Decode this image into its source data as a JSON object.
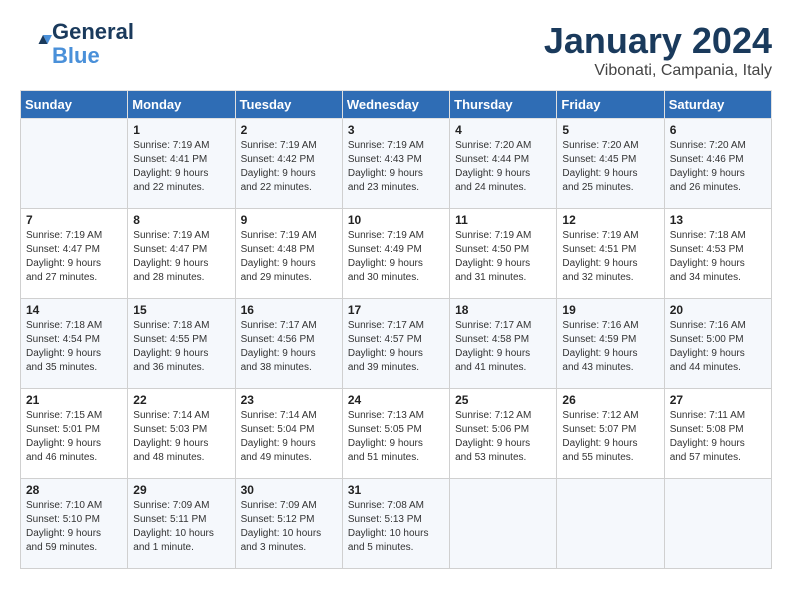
{
  "logo": {
    "line1": "General",
    "line2": "Blue"
  },
  "title": "January 2024",
  "subtitle": "Vibonati, Campania, Italy",
  "days_of_week": [
    "Sunday",
    "Monday",
    "Tuesday",
    "Wednesday",
    "Thursday",
    "Friday",
    "Saturday"
  ],
  "weeks": [
    [
      {
        "day": "",
        "content": ""
      },
      {
        "day": "1",
        "content": "Sunrise: 7:19 AM\nSunset: 4:41 PM\nDaylight: 9 hours\nand 22 minutes."
      },
      {
        "day": "2",
        "content": "Sunrise: 7:19 AM\nSunset: 4:42 PM\nDaylight: 9 hours\nand 22 minutes."
      },
      {
        "day": "3",
        "content": "Sunrise: 7:19 AM\nSunset: 4:43 PM\nDaylight: 9 hours\nand 23 minutes."
      },
      {
        "day": "4",
        "content": "Sunrise: 7:20 AM\nSunset: 4:44 PM\nDaylight: 9 hours\nand 24 minutes."
      },
      {
        "day": "5",
        "content": "Sunrise: 7:20 AM\nSunset: 4:45 PM\nDaylight: 9 hours\nand 25 minutes."
      },
      {
        "day": "6",
        "content": "Sunrise: 7:20 AM\nSunset: 4:46 PM\nDaylight: 9 hours\nand 26 minutes."
      }
    ],
    [
      {
        "day": "7",
        "content": "Sunrise: 7:19 AM\nSunset: 4:47 PM\nDaylight: 9 hours\nand 27 minutes."
      },
      {
        "day": "8",
        "content": "Sunrise: 7:19 AM\nSunset: 4:47 PM\nDaylight: 9 hours\nand 28 minutes."
      },
      {
        "day": "9",
        "content": "Sunrise: 7:19 AM\nSunset: 4:48 PM\nDaylight: 9 hours\nand 29 minutes."
      },
      {
        "day": "10",
        "content": "Sunrise: 7:19 AM\nSunset: 4:49 PM\nDaylight: 9 hours\nand 30 minutes."
      },
      {
        "day": "11",
        "content": "Sunrise: 7:19 AM\nSunset: 4:50 PM\nDaylight: 9 hours\nand 31 minutes."
      },
      {
        "day": "12",
        "content": "Sunrise: 7:19 AM\nSunset: 4:51 PM\nDaylight: 9 hours\nand 32 minutes."
      },
      {
        "day": "13",
        "content": "Sunrise: 7:18 AM\nSunset: 4:53 PM\nDaylight: 9 hours\nand 34 minutes."
      }
    ],
    [
      {
        "day": "14",
        "content": "Sunrise: 7:18 AM\nSunset: 4:54 PM\nDaylight: 9 hours\nand 35 minutes."
      },
      {
        "day": "15",
        "content": "Sunrise: 7:18 AM\nSunset: 4:55 PM\nDaylight: 9 hours\nand 36 minutes."
      },
      {
        "day": "16",
        "content": "Sunrise: 7:17 AM\nSunset: 4:56 PM\nDaylight: 9 hours\nand 38 minutes."
      },
      {
        "day": "17",
        "content": "Sunrise: 7:17 AM\nSunset: 4:57 PM\nDaylight: 9 hours\nand 39 minutes."
      },
      {
        "day": "18",
        "content": "Sunrise: 7:17 AM\nSunset: 4:58 PM\nDaylight: 9 hours\nand 41 minutes."
      },
      {
        "day": "19",
        "content": "Sunrise: 7:16 AM\nSunset: 4:59 PM\nDaylight: 9 hours\nand 43 minutes."
      },
      {
        "day": "20",
        "content": "Sunrise: 7:16 AM\nSunset: 5:00 PM\nDaylight: 9 hours\nand 44 minutes."
      }
    ],
    [
      {
        "day": "21",
        "content": "Sunrise: 7:15 AM\nSunset: 5:01 PM\nDaylight: 9 hours\nand 46 minutes."
      },
      {
        "day": "22",
        "content": "Sunrise: 7:14 AM\nSunset: 5:03 PM\nDaylight: 9 hours\nand 48 minutes."
      },
      {
        "day": "23",
        "content": "Sunrise: 7:14 AM\nSunset: 5:04 PM\nDaylight: 9 hours\nand 49 minutes."
      },
      {
        "day": "24",
        "content": "Sunrise: 7:13 AM\nSunset: 5:05 PM\nDaylight: 9 hours\nand 51 minutes."
      },
      {
        "day": "25",
        "content": "Sunrise: 7:12 AM\nSunset: 5:06 PM\nDaylight: 9 hours\nand 53 minutes."
      },
      {
        "day": "26",
        "content": "Sunrise: 7:12 AM\nSunset: 5:07 PM\nDaylight: 9 hours\nand 55 minutes."
      },
      {
        "day": "27",
        "content": "Sunrise: 7:11 AM\nSunset: 5:08 PM\nDaylight: 9 hours\nand 57 minutes."
      }
    ],
    [
      {
        "day": "28",
        "content": "Sunrise: 7:10 AM\nSunset: 5:10 PM\nDaylight: 9 hours\nand 59 minutes."
      },
      {
        "day": "29",
        "content": "Sunrise: 7:09 AM\nSunset: 5:11 PM\nDaylight: 10 hours\nand 1 minute."
      },
      {
        "day": "30",
        "content": "Sunrise: 7:09 AM\nSunset: 5:12 PM\nDaylight: 10 hours\nand 3 minutes."
      },
      {
        "day": "31",
        "content": "Sunrise: 7:08 AM\nSunset: 5:13 PM\nDaylight: 10 hours\nand 5 minutes."
      },
      {
        "day": "",
        "content": ""
      },
      {
        "day": "",
        "content": ""
      },
      {
        "day": "",
        "content": ""
      }
    ]
  ]
}
